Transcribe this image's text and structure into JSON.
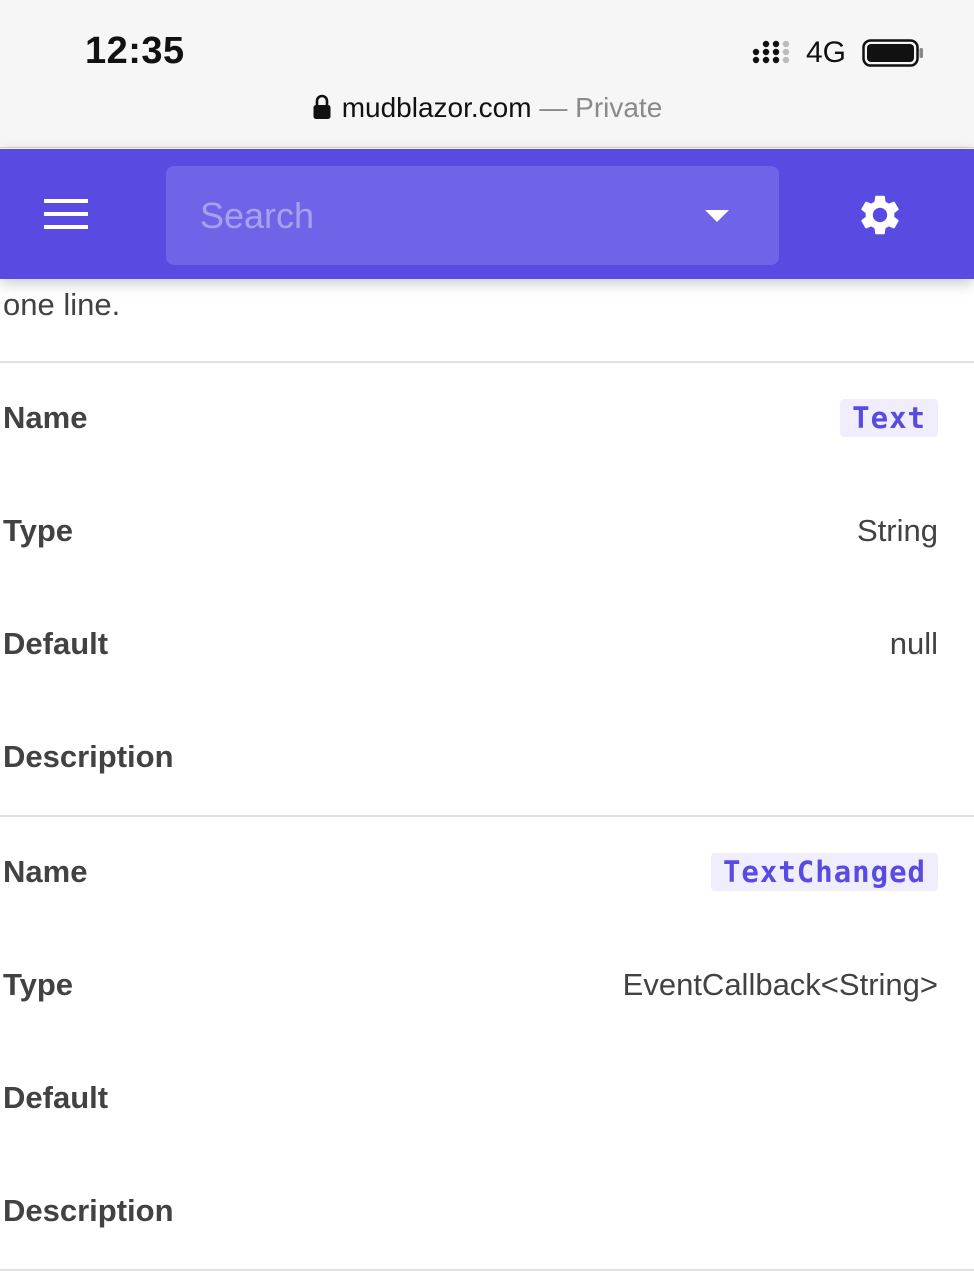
{
  "status_bar": {
    "time": "12:35",
    "network": "4G"
  },
  "browser": {
    "domain": "mudblazor.com",
    "separator": " — ",
    "mode": "Private"
  },
  "app_bar": {
    "background": "#594ae2",
    "search_placeholder": "Search"
  },
  "content": {
    "intro_text": "one line.",
    "properties": [
      {
        "name_label": "Name",
        "name_value": "Text",
        "type_label": "Type",
        "type_value": "String",
        "default_label": "Default",
        "default_value": "null",
        "description_label": "Description",
        "description_value": ""
      },
      {
        "name_label": "Name",
        "name_value": "TextChanged",
        "type_label": "Type",
        "type_value": "EventCallback<String>",
        "default_label": "Default",
        "default_value": "",
        "description_label": "Description",
        "description_value": ""
      }
    ]
  },
  "icons": {
    "lock": "lock-icon",
    "signal": "cellular-signal-icon",
    "battery": "battery-icon",
    "menu": "hamburger-menu-icon",
    "dropdown": "caret-down-icon",
    "settings": "gear-icon"
  }
}
